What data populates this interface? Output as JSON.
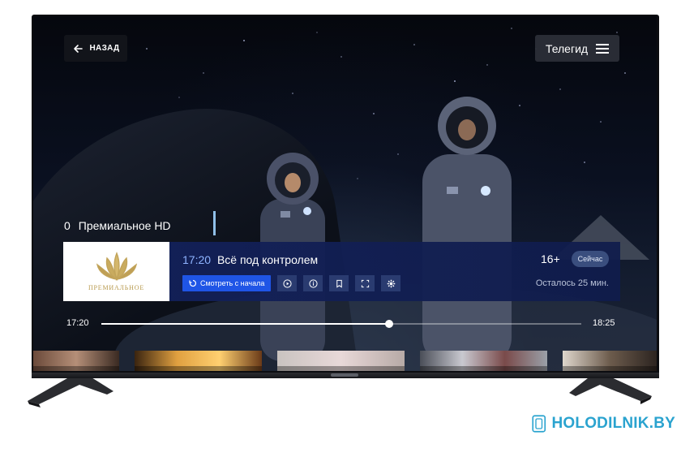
{
  "header": {
    "back_label": "НАЗАД",
    "tvguide_label": "Телегид"
  },
  "channel": {
    "number": "0",
    "name": "Премиальное HD",
    "logo_text": "ПРЕМИАЛЬНОЕ"
  },
  "program": {
    "time": "17:20",
    "title": "Всё под контролем",
    "age_rating": "16+",
    "now_badge": "Сейчас",
    "remaining": "Осталось 25 мин."
  },
  "controls": {
    "watch_from_start": "Смотреть с начала",
    "icons": [
      "play-icon",
      "info-icon",
      "bookmark-icon",
      "fullscreen-icon",
      "settings-icon"
    ]
  },
  "progress": {
    "start": "17:20",
    "end": "18:25",
    "fraction": 0.6
  },
  "watermark": {
    "text": "HOLODILNIK.BY"
  },
  "colors": {
    "accent_blue": "#1f55e6",
    "panel_navy": "#122058",
    "watermark": "#2aa3cf",
    "logo_gold": "#b89a4e"
  }
}
